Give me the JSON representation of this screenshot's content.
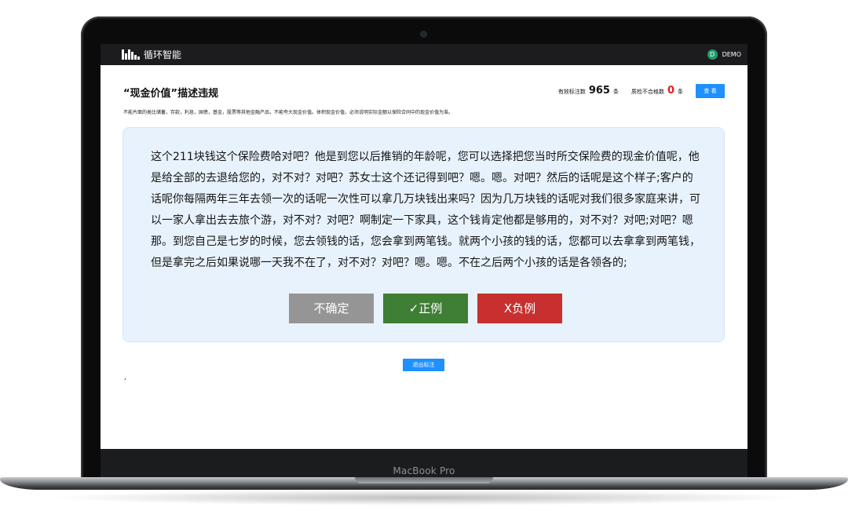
{
  "device": {
    "model_label": "MacBook Pro"
  },
  "topbar": {
    "brand": "循环智能",
    "user_initial": "D",
    "username": "DEMO"
  },
  "header": {
    "title": "“现金价值”描述违规",
    "valid_label": "有效标注数",
    "valid_count": "965",
    "valid_unit": "条",
    "fail_label": "质检不合格数",
    "fail_count": "0",
    "fail_unit": "条",
    "view_button": "查 看"
  },
  "rule_text": "不能片面的类比储蓄，存款，利息，国债，基金，股票等其他金融产品，不能夸大现金价值。体积现金价值，必须说明实际金额以保险合同中的现金价值为准。",
  "transcript": "这个211块钱这个保险费哈对吧？他是到您以后推销的年龄呢，您可以选择把您当时所交保险费的现金价值呢，他是给全部的去退给您的，对不对？对吧？苏女士这个还记得到吧？嗯。嗯。对吧？然后的话呢是这个样子;客户的话呢你每隔两年三年去领一次的话呢一次性可以拿几万块钱出来吗？因为几万块钱的话呢对我们很多家庭来讲，可以一家人拿出去去旅个游，对不对？对吧？啊制定一下家具，这个钱肯定他都是够用的，对不对？对吧;对吧？嗯那。到您自己是七岁的时候，您去领钱的话，您会拿到两笔钱。就两个小孩的钱的话，您都可以去拿拿到两笔钱，但是拿完之后如果说哪一天我不在了，对不对？对吧？嗯。嗯。不在之后两个小孩的话是各领各的;",
  "actions": {
    "unsure": "不确定",
    "positive": "✓正例",
    "negative": "X负例",
    "exit": "退出标注"
  },
  "stray_mark": ",",
  "colors": {
    "topbar": "#1c1c1e",
    "accent_blue": "#1e90ff",
    "card_bg": "#e8f2fc",
    "unsure_gray": "#959595",
    "positive_green": "#3f7e35",
    "negative_red": "#c7302f",
    "avatar_green": "#1f9d6b",
    "fail_count_red": "#e02020"
  }
}
